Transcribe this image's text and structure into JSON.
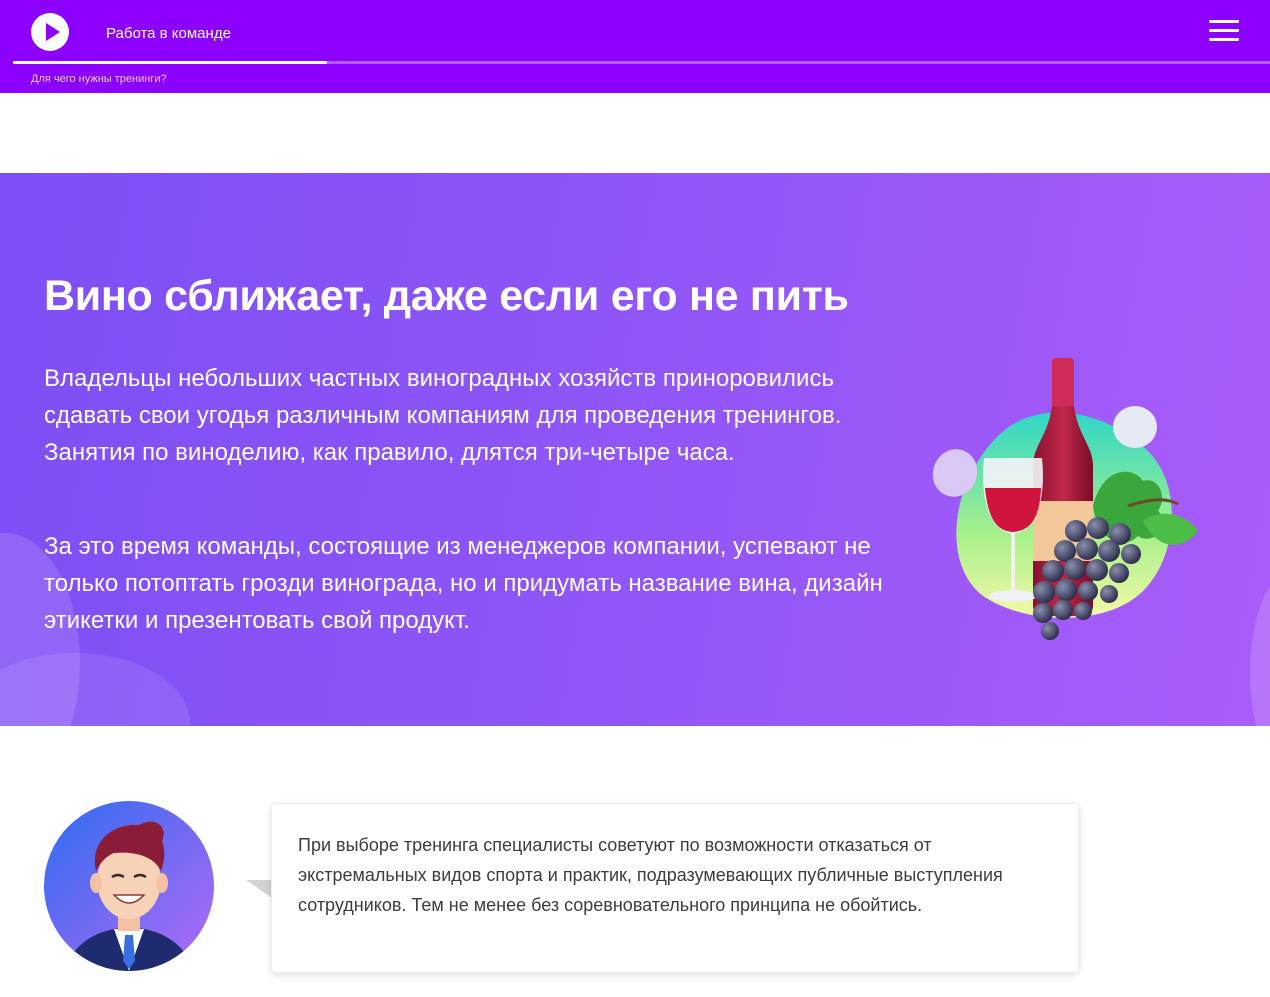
{
  "topbar": {
    "course_title": "Работа в команде",
    "section_label": "Для чего нужны тренинги?",
    "progress": 0.25,
    "play_icon": "play-icon",
    "menu_icon": "hamburger-menu-icon"
  },
  "hero": {
    "title": "Вино сближает, даже если его не пить",
    "paragraph_1": "Владельцы небольших частных виноградных хозяйств приноровились сдавать свои угодья различным компаниям для проведения тренингов. Занятия по виноделию, как правило, длятся три-четыре часа.",
    "paragraph_2": "За это время команды, состоящие из менеджеров компании, успевают не только потоптать грозди винограда, но и придумать название вина, дизайн этикетки и презентовать свой продукт.",
    "illustration": "wine-bottle-glass-grapes-illustration"
  },
  "expert": {
    "avatar": "businessman-avatar",
    "quote": "При выборе тренинга специалисты советуют по возможности отказаться от экстремальных видов спорта и практик, подразумевающих публичные выступления сотрудников. Тем не менее без соревновательного принципа не обойтись."
  },
  "colors": {
    "topbar_bg": "#8c00ff",
    "hero_gradient_start": "#7d4ff5",
    "hero_gradient_end": "#a95cf9",
    "text_dark": "#3c3c3c"
  }
}
